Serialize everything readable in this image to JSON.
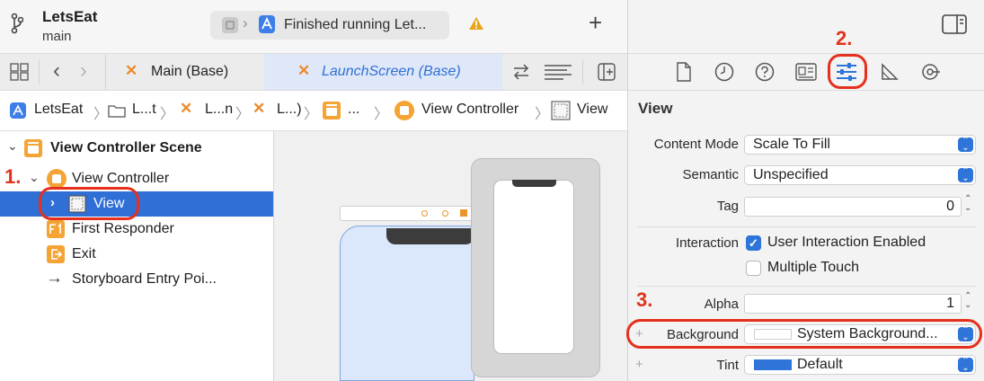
{
  "titlebar": {
    "project": "LetsEat",
    "branch": "main",
    "status": "Finished running Let...",
    "add_label": "+"
  },
  "tabs": [
    {
      "label": "Main (Base)"
    },
    {
      "label": "LaunchScreen (Base)"
    }
  ],
  "jumpbar": {
    "items": [
      "LetsEat",
      "L...t",
      "L...n",
      "L...)",
      "...",
      "View Controller",
      "View"
    ]
  },
  "outline": {
    "scene": "View Controller Scene",
    "items": [
      "View Controller",
      "View",
      "First Responder",
      "Exit",
      "Storyboard Entry Poi..."
    ]
  },
  "annotations": {
    "step1": "1.",
    "step2": "2.",
    "step3": "3."
  },
  "inspector": {
    "section": "View",
    "content_mode_label": "Content Mode",
    "content_mode_value": "Scale To Fill",
    "semantic_label": "Semantic",
    "semantic_value": "Unspecified",
    "tag_label": "Tag",
    "tag_value": "0",
    "interaction_label": "Interaction",
    "user_interaction": "User Interaction Enabled",
    "multiple_touch": "Multiple Touch",
    "alpha_label": "Alpha",
    "alpha_value": "1",
    "background_label": "Background",
    "background_value": "System Background...",
    "tint_label": "Tint",
    "tint_value": "Default"
  },
  "colors": {
    "accent": "#2f74d8",
    "selection": "#2f6fd6",
    "annotation": "#e4301d",
    "storyboard_icon": "#ee8a2c",
    "tint_swatch": "#2f74d8"
  },
  "icons": [
    "branch-icon",
    "warning-icon",
    "plus-icon",
    "sidebar-toggle-icon",
    "grid-icon",
    "back-icon",
    "forward-icon",
    "swap-icon",
    "lines-icon",
    "add-editor-icon",
    "file-inspector-icon",
    "history-icon",
    "help-icon",
    "identity-icon",
    "attributes-icon",
    "size-icon",
    "connections-icon"
  ]
}
